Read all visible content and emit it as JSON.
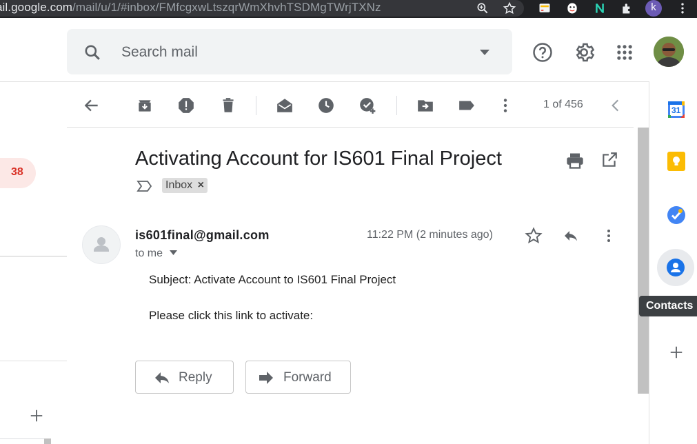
{
  "browser": {
    "url_prefix": "ail.google.com",
    "url_path": "/mail/u/1/#inbox/FMfcgxwLtszqrWmXhvhTSDMgTWrjTXNz",
    "profile_initial": "k"
  },
  "header": {
    "search_placeholder": "Search mail"
  },
  "nav": {
    "inbox_count": "38"
  },
  "toolbar": {
    "pager": "1 of 456"
  },
  "message": {
    "subject": "Activating Account for IS601 Final Project",
    "label": "Inbox",
    "label_remove": "×",
    "sender": "is601final@gmail.com",
    "recipient": "to me",
    "time": "11:22 PM (2 minutes ago)",
    "body_line1": "Subject: Activate Account to IS601 Final Project",
    "body_line2": "Please click this link to activate:"
  },
  "actions": {
    "reply": "Reply",
    "forward": "Forward"
  },
  "side_panel": {
    "calendar_day": "31",
    "tooltip": "Contacts"
  },
  "colors": {
    "accent_red": "#d93025",
    "badge_bg": "#fce8e6",
    "icon_gray": "#5f6368"
  }
}
